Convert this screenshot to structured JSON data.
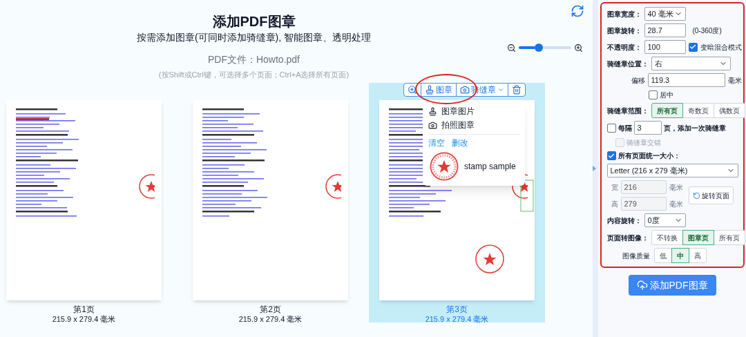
{
  "header": {
    "title": "添加PDF图章",
    "subtitle": "按需添加图章(可同时添加骑缝章), 智能图章、透明处理",
    "file_label": "PDF文件：Howto.pdf",
    "hint": "(按Shift或Ctrl键，可选择多个页面；Ctrl+A选择所有页面)"
  },
  "zoom": {
    "level": 0.3
  },
  "pages": [
    {
      "label": "第1页",
      "size": "215.9 x 279.4 毫米",
      "selected": false,
      "stamped": false
    },
    {
      "label": "第2页",
      "size": "215.9 x 279.4 毫米",
      "selected": false,
      "stamped": false
    },
    {
      "label": "第3页",
      "size": "215.9 x 279.4 毫米",
      "selected": true,
      "stamped": true
    }
  ],
  "page_toolbar": [
    {
      "kind": "zoom"
    },
    {
      "kind": "stamp",
      "label": "图章"
    },
    {
      "kind": "seam",
      "label": "骑缝章"
    },
    {
      "kind": "delete"
    }
  ],
  "stamp_menu": {
    "items": [
      {
        "kind": "stamp",
        "label": "图章图片"
      },
      {
        "kind": "camera",
        "label": "拍照图章"
      }
    ],
    "actions": [
      "清空",
      "删改"
    ],
    "stamps": [
      {
        "label": "stamp sample"
      }
    ]
  },
  "panel": {
    "stamp_width": {
      "label": "图章宽度：",
      "value": "40 毫米"
    },
    "rotation": {
      "label": "图章旋转：",
      "value": "28.7",
      "hint": "(0-360度)"
    },
    "opacity": {
      "label": "不透明度：",
      "value": "100",
      "darken": {
        "label": "变暗混合模式",
        "checked": true
      }
    },
    "seam_position": {
      "label": "骑缝章位置：",
      "value": "右"
    },
    "offset": {
      "label": "偏移",
      "value": "119.3",
      "unit": "毫米"
    },
    "center": {
      "label": "居中",
      "checked": false
    },
    "seam_range": {
      "label": "骑缝章范围：",
      "options": [
        {
          "label": "所有页",
          "selected": true
        },
        {
          "label": "奇数页",
          "selected": false
        },
        {
          "label": "偶数页",
          "selected": false
        }
      ]
    },
    "every": {
      "checked": false,
      "label": "每隔",
      "value": "3",
      "suffix": "页，添加一次骑缝章"
    },
    "stagger": {
      "label": "骑缝章交错",
      "checked": false,
      "disabled": true
    },
    "uniform_size": {
      "checked": true,
      "label": "所有页面统一大小：",
      "preset": "Letter (216 x 279 毫米)",
      "width": {
        "label": "宽",
        "value": "216",
        "unit": "毫米"
      },
      "height": {
        "label": "高",
        "value": "279",
        "unit": "毫米"
      },
      "rotate_button": "旋转页面"
    },
    "content_rotation": {
      "label": "内容旋转：",
      "value": "0度"
    },
    "page_to_image": {
      "label": "页面转图像：",
      "options": [
        {
          "label": "不转换",
          "selected": false
        },
        {
          "label": "图章页",
          "selected": true
        },
        {
          "label": "所有页",
          "selected": false
        }
      ]
    },
    "quality": {
      "label": "图像质量",
      "options": [
        {
          "label": "低",
          "selected": false
        },
        {
          "label": "中",
          "selected": true
        },
        {
          "label": "高",
          "selected": false
        }
      ]
    }
  },
  "submit": "添加PDF图章"
}
